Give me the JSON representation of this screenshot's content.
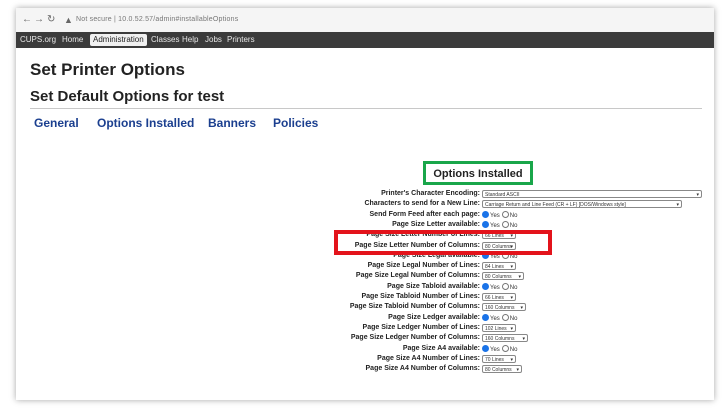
{
  "browser": {
    "back": "←",
    "forward": "→",
    "reload": "↻",
    "warning": "▲",
    "security": "Not secure",
    "url": "10.0.52.57/admin#installableOptions"
  },
  "menu": {
    "items": [
      "CUPS.org",
      "Home",
      "Administration",
      "Classes",
      "Help",
      "Jobs",
      "Printers"
    ]
  },
  "page": {
    "title": "Set Printer Options",
    "subtitle": "Set Default Options for test"
  },
  "tabs": [
    "General",
    "Options Installed",
    "Banners",
    "Policies"
  ],
  "section_title": "Options Installed",
  "rows": [
    {
      "label": "Printer's Character Encoding:",
      "type": "select",
      "value": "Standard ASCII"
    },
    {
      "label": "Characters to send for a New Line:",
      "type": "select",
      "value": "Carriage Return and Line Feed (CR + LF) [DOS/Windows style]"
    },
    {
      "label": "Send Form Feed after each page:",
      "type": "radio",
      "value": "Yes"
    },
    {
      "label": "Page Size Letter available:",
      "type": "radio",
      "value": "Yes"
    },
    {
      "label": "Page Size Letter Number of Lines:",
      "type": "select",
      "value": "66 Lines"
    },
    {
      "label": "Page Size Letter Number of Columns:",
      "type": "select",
      "value": "80 Columns"
    },
    {
      "label": "Page Size Legal available:",
      "type": "radio",
      "value": "Yes"
    },
    {
      "label": "Page Size Legal Number of Lines:",
      "type": "select",
      "value": "84 Lines"
    },
    {
      "label": "Page Size Legal Number of Columns:",
      "type": "select",
      "value": "80 Columns"
    },
    {
      "label": "Page Size Tabloid available:",
      "type": "radio",
      "value": "Yes"
    },
    {
      "label": "Page Size Tabloid Number of Lines:",
      "type": "select",
      "value": "66 Lines"
    },
    {
      "label": "Page Size Tabloid Number of Columns:",
      "type": "select",
      "value": "160 Columns"
    },
    {
      "label": "Page Size Ledger available:",
      "type": "radio",
      "value": "Yes"
    },
    {
      "label": "Page Size Ledger Number of Lines:",
      "type": "select",
      "value": "102 Lines"
    },
    {
      "label": "Page Size Ledger Number of Columns:",
      "type": "select",
      "value": "160 Columns"
    },
    {
      "label": "Page Size A4 available:",
      "type": "radio",
      "value": "Yes"
    },
    {
      "label": "Page Size A4 Number of Lines:",
      "type": "select",
      "value": "70 Lines"
    },
    {
      "label": "Page Size A4 Number of Columns:",
      "type": "select",
      "value": "80 Columns"
    }
  ],
  "radio_labels": {
    "yes": "Yes",
    "no": "No"
  },
  "colors": {
    "section_highlight": "#19a64a",
    "row_highlight": "#e3131b",
    "tab_link": "#1b3f8f",
    "menubar": "#3b3b3b"
  }
}
